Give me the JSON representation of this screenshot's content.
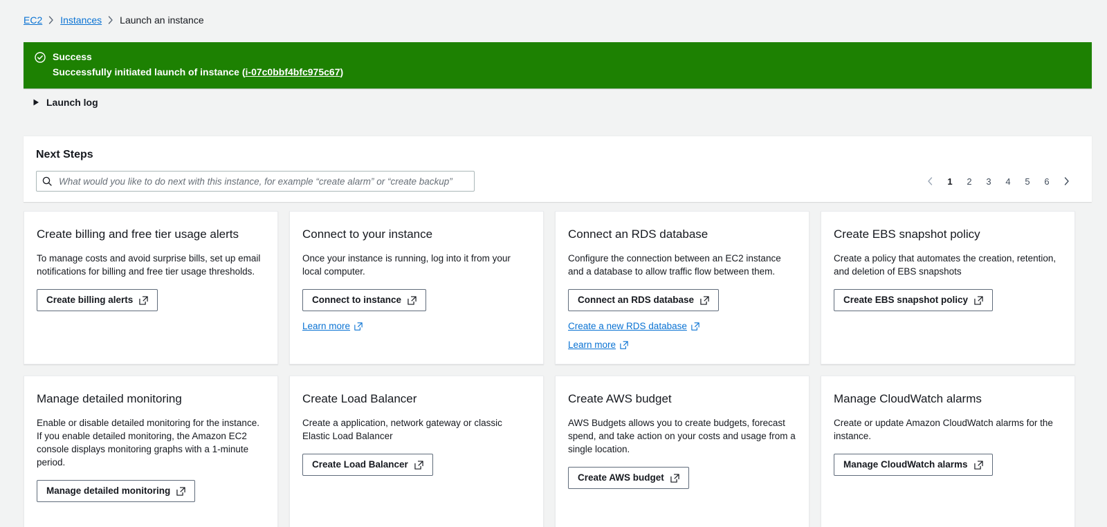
{
  "breadcrumb": {
    "items": [
      {
        "label": "EC2",
        "type": "link"
      },
      {
        "label": "Instances",
        "type": "link"
      },
      {
        "label": "Launch an instance",
        "type": "current"
      }
    ]
  },
  "banner": {
    "icon": "success-check-icon",
    "title": "Success",
    "message_prefix": "Successfully initiated launch of instance (",
    "instance_id": "i-07c0bbf4bfc975c67",
    "message_suffix": ")",
    "color": "#1d8102"
  },
  "launch_log": {
    "label": "Launch log",
    "expanded": false
  },
  "next_steps": {
    "title": "Next Steps",
    "search": {
      "placeholder": "What would you like to do next with this instance, for example “create alarm” or “create backup”",
      "value": ""
    },
    "pagination": {
      "prev_label": "‹",
      "next_label": "›",
      "pages": [
        "1",
        "2",
        "3",
        "4",
        "5",
        "6"
      ],
      "current": "1"
    }
  },
  "cards": [
    {
      "title": "Create billing and free tier usage alerts",
      "body": "To manage costs and avoid surprise bills, set up email notifications for billing and free tier usage thresholds.",
      "button": "Create billing alerts",
      "links": []
    },
    {
      "title": "Connect to your instance",
      "body": "Once your instance is running, log into it from your local computer.",
      "button": "Connect to instance",
      "links": [
        "Learn more"
      ]
    },
    {
      "title": "Connect an RDS database",
      "body": "Configure the connection between an EC2 instance and a database to allow traffic flow between them.",
      "button": "Connect an RDS database",
      "links": [
        "Create a new RDS database",
        "Learn more"
      ]
    },
    {
      "title": "Create EBS snapshot policy",
      "body": "Create a policy that automates the creation, retention, and deletion of EBS snapshots",
      "button": "Create EBS snapshot policy",
      "links": []
    },
    {
      "title": "Manage detailed monitoring",
      "body": "Enable or disable detailed monitoring for the instance. If you enable detailed monitoring, the Amazon EC2 console displays monitoring graphs with a 1-minute period.",
      "button": "Manage detailed monitoring",
      "links": []
    },
    {
      "title": "Create Load Balancer",
      "body": "Create a application, network gateway or classic Elastic Load Balancer",
      "button": "Create Load Balancer",
      "links": []
    },
    {
      "title": "Create AWS budget",
      "body": "AWS Budgets allows you to create budgets, forecast spend, and take action on your costs and usage from a single location.",
      "button": "Create AWS budget",
      "links": []
    },
    {
      "title": "Manage CloudWatch alarms",
      "body": "Create or update Amazon CloudWatch alarms for the instance.",
      "button": "Manage CloudWatch alarms",
      "links": []
    }
  ],
  "colors": {
    "page_background": "#f2f3f3",
    "link": "#0972d3",
    "success": "#1d8102",
    "text": "#16191f"
  }
}
